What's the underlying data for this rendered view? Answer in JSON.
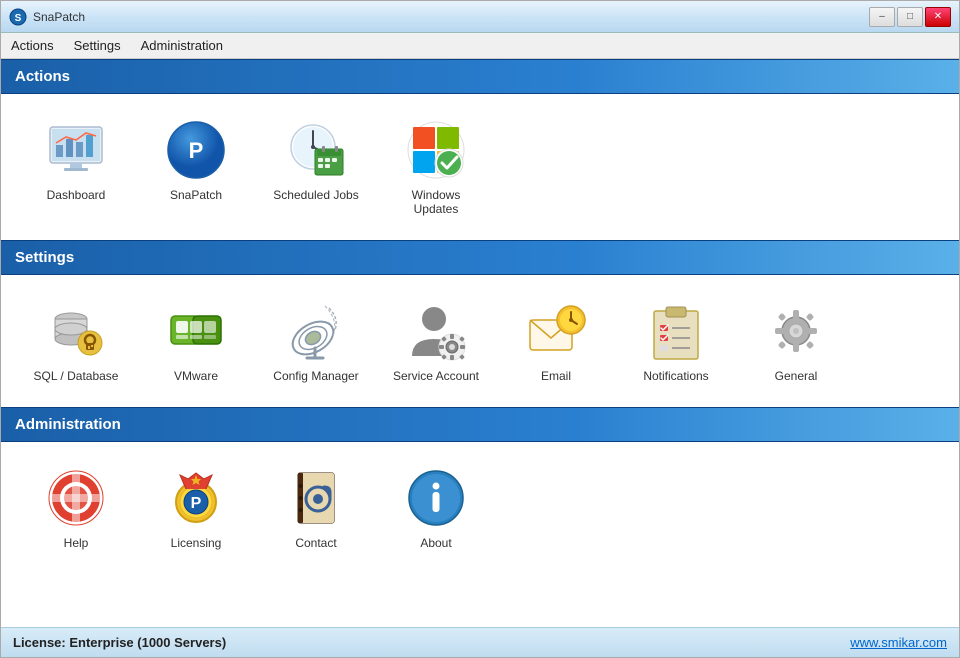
{
  "window": {
    "title": "SnaPatch"
  },
  "titlebar": {
    "title": "SnaPatch",
    "minimize_label": "–",
    "maximize_label": "□",
    "close_label": "✕"
  },
  "menubar": {
    "items": [
      {
        "id": "actions",
        "label": "Actions"
      },
      {
        "id": "settings",
        "label": "Settings"
      },
      {
        "id": "administration",
        "label": "Administration"
      }
    ]
  },
  "sections": [
    {
      "id": "actions",
      "header": "Actions",
      "items": [
        {
          "id": "dashboard",
          "label": "Dashboard"
        },
        {
          "id": "snapatch",
          "label": "SnaPatch"
        },
        {
          "id": "scheduled-jobs",
          "label": "Scheduled Jobs"
        },
        {
          "id": "windows-updates",
          "label": "Windows Updates"
        }
      ]
    },
    {
      "id": "settings",
      "header": "Settings",
      "items": [
        {
          "id": "sql-database",
          "label": "SQL / Database"
        },
        {
          "id": "vmware",
          "label": "VMware"
        },
        {
          "id": "config-manager",
          "label": "Config Manager"
        },
        {
          "id": "service-account",
          "label": "Service Account"
        },
        {
          "id": "email",
          "label": "Email"
        },
        {
          "id": "notifications",
          "label": "Notifications"
        },
        {
          "id": "general",
          "label": "General"
        }
      ]
    },
    {
      "id": "administration",
      "header": "Administration",
      "items": [
        {
          "id": "help",
          "label": "Help"
        },
        {
          "id": "licensing",
          "label": "Licensing"
        },
        {
          "id": "contact",
          "label": "Contact"
        },
        {
          "id": "about",
          "label": "About"
        }
      ]
    }
  ],
  "statusbar": {
    "license_text": "License: Enterprise (1000 Servers)",
    "website_text": "www.smikar.com",
    "website_url": "http://www.smikar.com"
  }
}
